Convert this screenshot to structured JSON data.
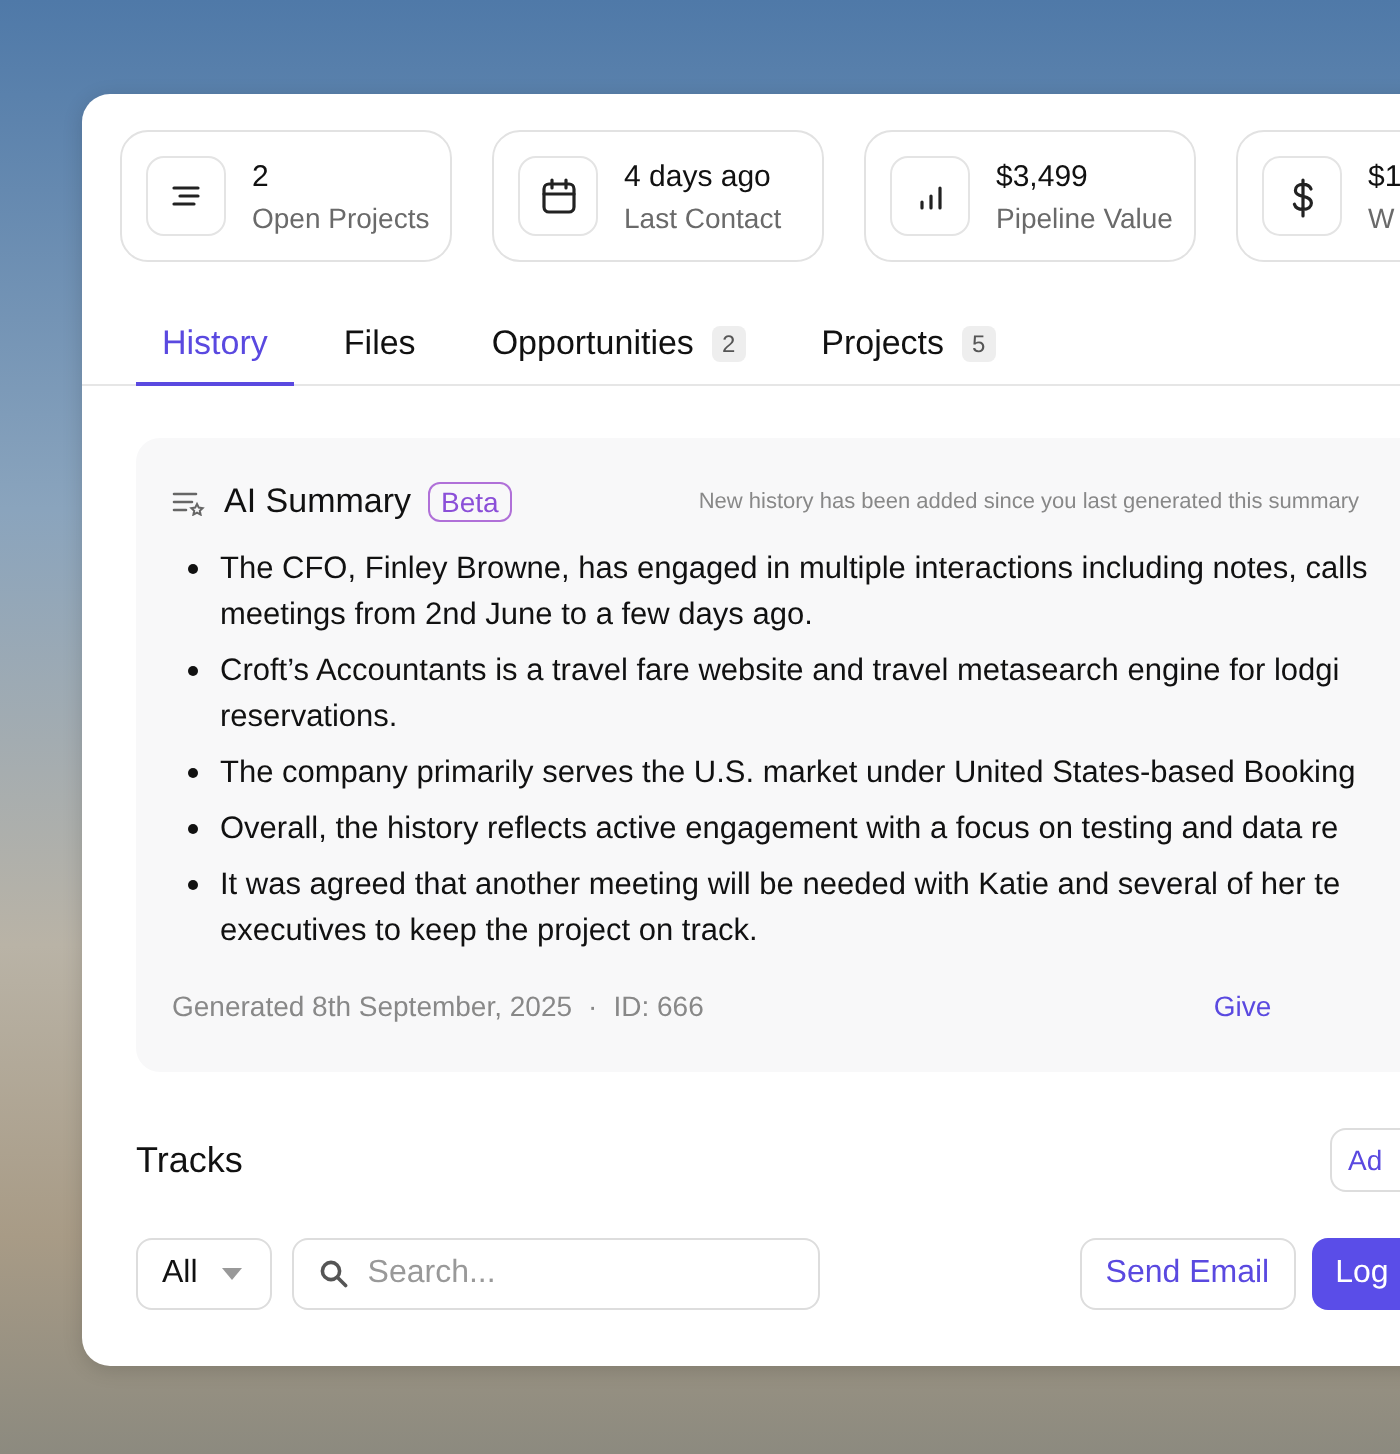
{
  "stats": [
    {
      "value": "2",
      "label": "Open Projects"
    },
    {
      "value": "4 days ago",
      "label": "Last Contact"
    },
    {
      "value": "$3,499",
      "label": "Pipeline Value"
    },
    {
      "value": "$1",
      "label": "W"
    }
  ],
  "tabs": [
    {
      "label": "History",
      "selected": true
    },
    {
      "label": "Files",
      "selected": false
    },
    {
      "label": "Opportunities",
      "count": "2",
      "selected": false
    },
    {
      "label": "Projects",
      "count": "5",
      "selected": false
    }
  ],
  "summary": {
    "title": "AI Summary",
    "badge": "Beta",
    "notice": "New history has been added since you last generated this summary",
    "bullets": [
      {
        "lines": [
          "The CFO, Finley Browne, has engaged in multiple interactions including notes, calls",
          "meetings from 2nd June to a few days ago."
        ]
      },
      {
        "lines": [
          "Croft’s Accountants is a travel fare website and travel metasearch engine for lodgi",
          "reservations."
        ]
      },
      {
        "lines": [
          "The company primarily serves the U.S. market under United States-based Booking"
        ]
      },
      {
        "lines": [
          "Overall, the history reflects active engagement with a focus on testing and data re"
        ]
      },
      {
        "lines": [
          "It was agreed that another meeting will be needed with Katie and several of her te",
          "executives to keep the project on track."
        ]
      }
    ],
    "generated": "Generated 8th September, 2025",
    "separator": "·",
    "id": "ID: 666",
    "link": "Give"
  },
  "tracks": {
    "title": "Tracks",
    "add": "Ad",
    "filter": "All",
    "search_placeholder": "Search...",
    "send": "Send Email",
    "log": "Log"
  }
}
